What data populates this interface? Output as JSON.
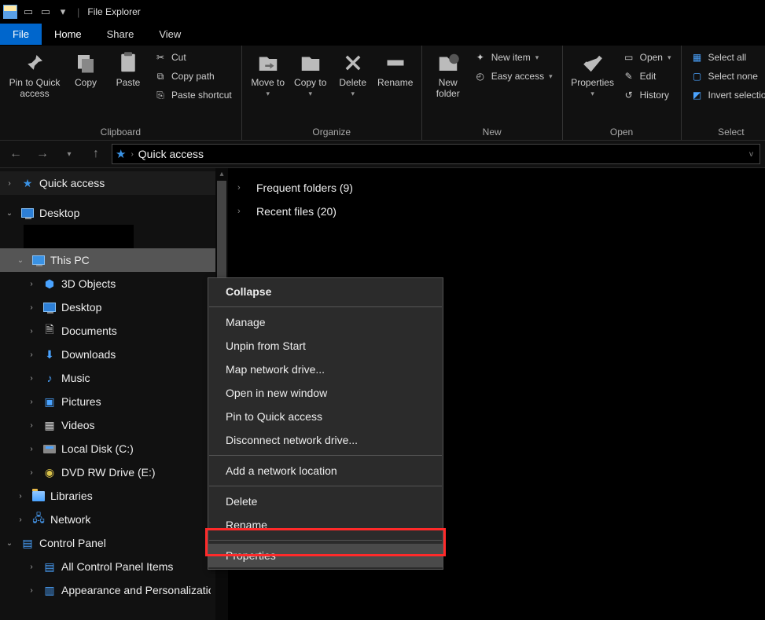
{
  "title": "File Explorer",
  "tabs": {
    "file": "File",
    "home": "Home",
    "share": "Share",
    "view": "View"
  },
  "ribbon": {
    "clipboard": {
      "pin": "Pin to Quick access",
      "copy": "Copy",
      "paste": "Paste",
      "cut": "Cut",
      "copy_path": "Copy path",
      "paste_shortcut": "Paste shortcut",
      "label": "Clipboard"
    },
    "organize": {
      "move": "Move to",
      "copy_to": "Copy to",
      "delete": "Delete",
      "rename": "Rename",
      "label": "Organize"
    },
    "new": {
      "folder": "New folder",
      "item": "New item",
      "easy": "Easy access",
      "label": "New"
    },
    "open": {
      "properties": "Properties",
      "open": "Open",
      "edit": "Edit",
      "history": "History",
      "label": "Open"
    },
    "select": {
      "all": "Select all",
      "none": "Select none",
      "invert": "Invert selection",
      "label": "Select"
    }
  },
  "address": {
    "location": "Quick access"
  },
  "tree": {
    "quick_access": "Quick access",
    "desktop": "Desktop",
    "this_pc": "This PC",
    "pc_children": {
      "objects3d": "3D Objects",
      "desktop": "Desktop",
      "documents": "Documents",
      "downloads": "Downloads",
      "music": "Music",
      "pictures": "Pictures",
      "videos": "Videos",
      "localdisk": "Local Disk (C:)",
      "dvd": "DVD RW Drive (E:)"
    },
    "libraries": "Libraries",
    "network": "Network",
    "control_panel": "Control Panel",
    "cp_children": {
      "all": "All Control Panel Items",
      "appearance": "Appearance and Personalization"
    }
  },
  "main": {
    "frequent": "Frequent folders (9)",
    "recent": "Recent files (20)"
  },
  "context_menu": {
    "collapse": "Collapse",
    "manage": "Manage",
    "unpin": "Unpin from Start",
    "map": "Map network drive...",
    "open_new": "Open in new window",
    "pin_quick": "Pin to Quick access",
    "disconnect": "Disconnect network drive...",
    "add_location": "Add a network location",
    "delete": "Delete",
    "rename": "Rename",
    "properties": "Properties"
  }
}
